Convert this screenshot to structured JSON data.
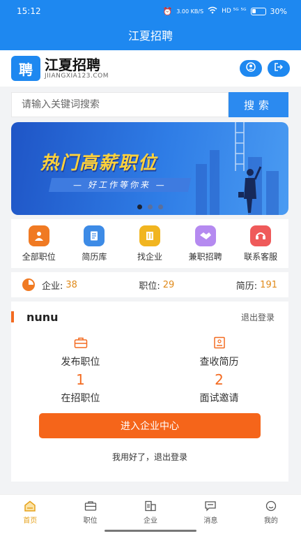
{
  "status_bar": {
    "time": "15:12",
    "network": "3.00 KB/S",
    "signal": "HD  ⁵ᴳ ⁵ᴳ",
    "battery": "30%"
  },
  "title_bar": {
    "title": "江夏招聘"
  },
  "header": {
    "logo_char": "聘",
    "logo_title": "江夏招聘",
    "logo_sub": "JIIANGXIA123.COM",
    "icons": [
      "user-icon",
      "logout-icon"
    ]
  },
  "search": {
    "placeholder": "请输入关键词搜索",
    "button": "搜索"
  },
  "banner": {
    "title": "热门高薪职位",
    "subtitle": "— 好工作等你来 —",
    "dots": 3,
    "active_dot": 0
  },
  "nav": [
    {
      "label": "全部职位",
      "icon": "person-icon",
      "color": "#f07a23"
    },
    {
      "label": "简历库",
      "icon": "resume-icon",
      "color": "#3d8be6"
    },
    {
      "label": "找企业",
      "icon": "building-icon",
      "color": "#f1b520"
    },
    {
      "label": "兼职招聘",
      "icon": "handshake-icon",
      "color": "#b58af0"
    },
    {
      "label": "联系客服",
      "icon": "phone-icon",
      "color": "#ef5a5a"
    }
  ],
  "stats": [
    {
      "label": "企业:",
      "value": "38"
    },
    {
      "label": "职位:",
      "value": "29"
    },
    {
      "label": "简历:",
      "value": "191"
    }
  ],
  "company": {
    "username": "nunu",
    "logout": "退出登录",
    "actions": [
      {
        "label": "发布职位",
        "icon": "briefcase-icon"
      },
      {
        "label": "查收简历",
        "icon": "resume-check-icon"
      }
    ],
    "counts": [
      {
        "value": "1",
        "label": "在招职位"
      },
      {
        "value": "2",
        "label": "面试邀请"
      }
    ],
    "enter_button": "进入企业中心",
    "bottom_link": "我用好了，退出登录"
  },
  "tabs": [
    {
      "label": "首页",
      "icon": "home-icon",
      "active": true
    },
    {
      "label": "职位",
      "icon": "briefcase-icon",
      "active": false
    },
    {
      "label": "企业",
      "icon": "building-icon",
      "active": false
    },
    {
      "label": "消息",
      "icon": "message-icon",
      "active": false
    },
    {
      "label": "我的",
      "icon": "profile-icon",
      "active": false
    }
  ]
}
